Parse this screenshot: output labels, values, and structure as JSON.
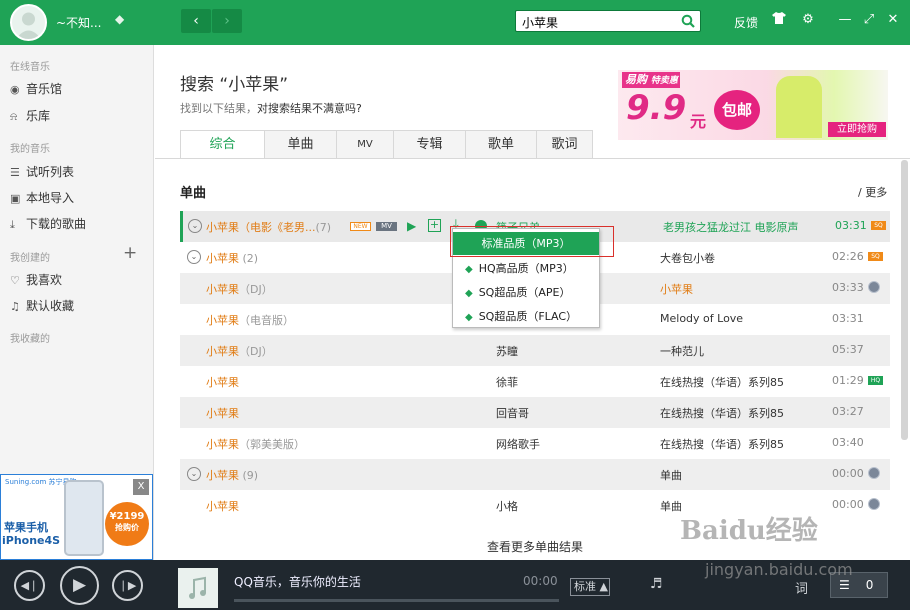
{
  "topbar": {
    "username": "~不知...",
    "search_value": "小苹果",
    "feedback": "反馈",
    "back": "‹",
    "forward": "›"
  },
  "sidebar": {
    "sections": [
      {
        "heading": "在线音乐",
        "items": [
          {
            "label": "音乐馆",
            "icon": "disc-icon"
          },
          {
            "label": "乐库",
            "icon": "headphones-icon"
          }
        ]
      },
      {
        "heading": "我的音乐",
        "items": [
          {
            "label": "试听列表",
            "icon": "list-icon"
          },
          {
            "label": "本地导入",
            "icon": "monitor-icon"
          },
          {
            "label": "下载的歌曲",
            "icon": "download-icon"
          }
        ]
      },
      {
        "heading": "我创建的",
        "items": [
          {
            "label": "我喜欢",
            "icon": "heart-icon"
          },
          {
            "label": "默认收藏",
            "icon": "note-icon"
          }
        ]
      },
      {
        "heading": "我收藏的",
        "items": []
      }
    ],
    "ad": {
      "brand": "Suning.com 苏宁易购",
      "line1": "苹果手机",
      "line2": "iPhone4S",
      "price": "¥2199",
      "price_sub": "抢购价",
      "close": "X"
    }
  },
  "main": {
    "search_title": "搜索 “小苹果”",
    "search_sub_prefix": "找到以下结果，",
    "search_sub_link": "对搜索结果不满意吗?",
    "banner": {
      "brand": "易购",
      "tag": "特卖惠",
      "price": "9.9",
      "unit": "元",
      "badge": "包邮",
      "cta": "立即抢购"
    },
    "tabs": [
      "综合",
      "单曲",
      "MV",
      "专辑",
      "歌单",
      "歌词"
    ],
    "active_tab": "综合",
    "section_title": "单曲",
    "more": "/ 更多",
    "songs": [
      {
        "title": "小苹果（电影《老男...",
        "count": "(7)",
        "new": "NEW",
        "mv": "MV",
        "artist": "筷子兄弟",
        "album": "老男孩之猛龙过江 电影原声",
        "time": "03:31",
        "badge": "SQ"
      },
      {
        "title": "小苹果",
        "count": "(2)",
        "artist": "",
        "album": "大卷包小卷",
        "time": "02:26",
        "badge": "SQ"
      },
      {
        "title": "小苹果",
        "note": "（DJ）",
        "artist": "",
        "album": "小苹果",
        "time": "03:33",
        "badge": "globe"
      },
      {
        "title": "小苹果",
        "note": "（电音版）",
        "artist": "",
        "album": "Melody of Love",
        "time": "03:31",
        "badge": ""
      },
      {
        "title": "小苹果",
        "note": "（DJ）",
        "artist": "苏瞳",
        "album": "一种范儿",
        "time": "05:37",
        "badge": ""
      },
      {
        "title": "小苹果",
        "note": "",
        "artist": "徐菲",
        "album": "在线热搜（华语）系列85",
        "time": "01:29",
        "badge": "HQ"
      },
      {
        "title": "小苹果",
        "note": "",
        "artist": "回音哥",
        "album": "在线热搜（华语）系列85",
        "time": "03:27",
        "badge": ""
      },
      {
        "title": "小苹果",
        "note": "（郭美美版）",
        "artist": "网络歌手",
        "album": "在线热搜（华语）系列85",
        "time": "03:40",
        "badge": ""
      },
      {
        "title": "小苹果",
        "count": "(9)",
        "artist": "",
        "album": "单曲",
        "time": "00:00",
        "badge": "globe"
      },
      {
        "title": "小苹果",
        "note": "",
        "artist": "小格",
        "album": "单曲",
        "time": "00:00",
        "badge": "globe"
      }
    ],
    "more_results": "查看更多单曲结果",
    "dropdown": {
      "selected": "标准品质（MP3）",
      "items": [
        "HQ高品质（MP3）",
        "SQ超品质（APE）",
        "SQ超品质（FLAC）"
      ]
    }
  },
  "player": {
    "now_playing": "QQ音乐，音乐你的生活",
    "time": "00:00",
    "quality": "标准",
    "lyric": "词",
    "queue_count": "0",
    "progress": 0
  },
  "watermark": {
    "main": "Baidu经验",
    "sub": "jingyan.baidu.com"
  }
}
